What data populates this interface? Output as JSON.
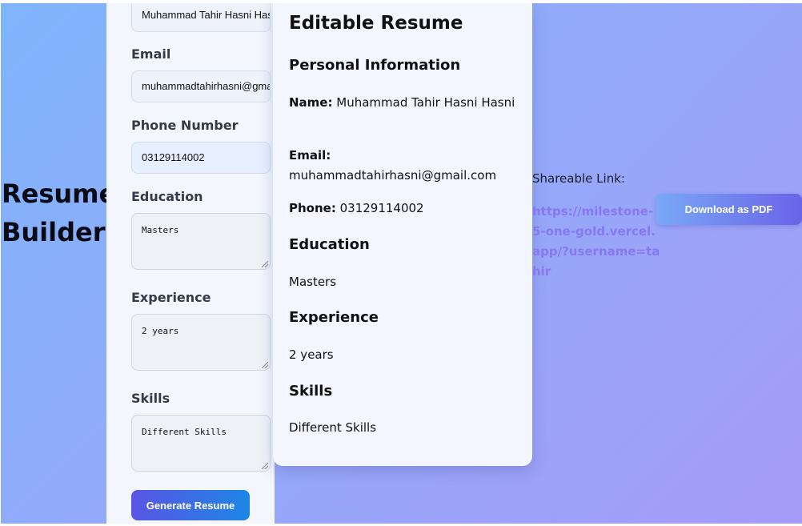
{
  "app": {
    "title": "Resume Builder"
  },
  "form": {
    "name_value": "Muhammad Tahir Hasni Hasni",
    "email_label": "Email",
    "email_value": "muhammadtahirhasni@gmail.com",
    "phone_label": "Phone Number",
    "phone_value": "03129114002",
    "education_label": "Education",
    "education_value": "Masters",
    "experience_label": "Experience",
    "experience_value": "2 years",
    "skills_label": "Skills",
    "skills_value": "Different Skills",
    "generate_button": "Generate Resume"
  },
  "resume": {
    "title": "Editable Resume",
    "personal_heading": "Personal Information",
    "name_label": "Name:",
    "name_value": "Muhammad Tahir Hasni Hasni",
    "email_label": "Email:",
    "email_value": "muhammadtahirhasni@gmail.com",
    "phone_label": "Phone:",
    "phone_value": "03129114002",
    "education_heading": "Education",
    "education_value": "Masters",
    "experience_heading": "Experience",
    "experience_value": "2 years",
    "skills_heading": "Skills",
    "skills_value": "Different Skills"
  },
  "share": {
    "label": "Shareable Link:",
    "url": "https://milestone-5-one-gold.vercel.app/?username=tahir",
    "download_button": "Download as PDF"
  },
  "colors": {
    "accent": "#5a55e4",
    "link": "#8877f2"
  }
}
